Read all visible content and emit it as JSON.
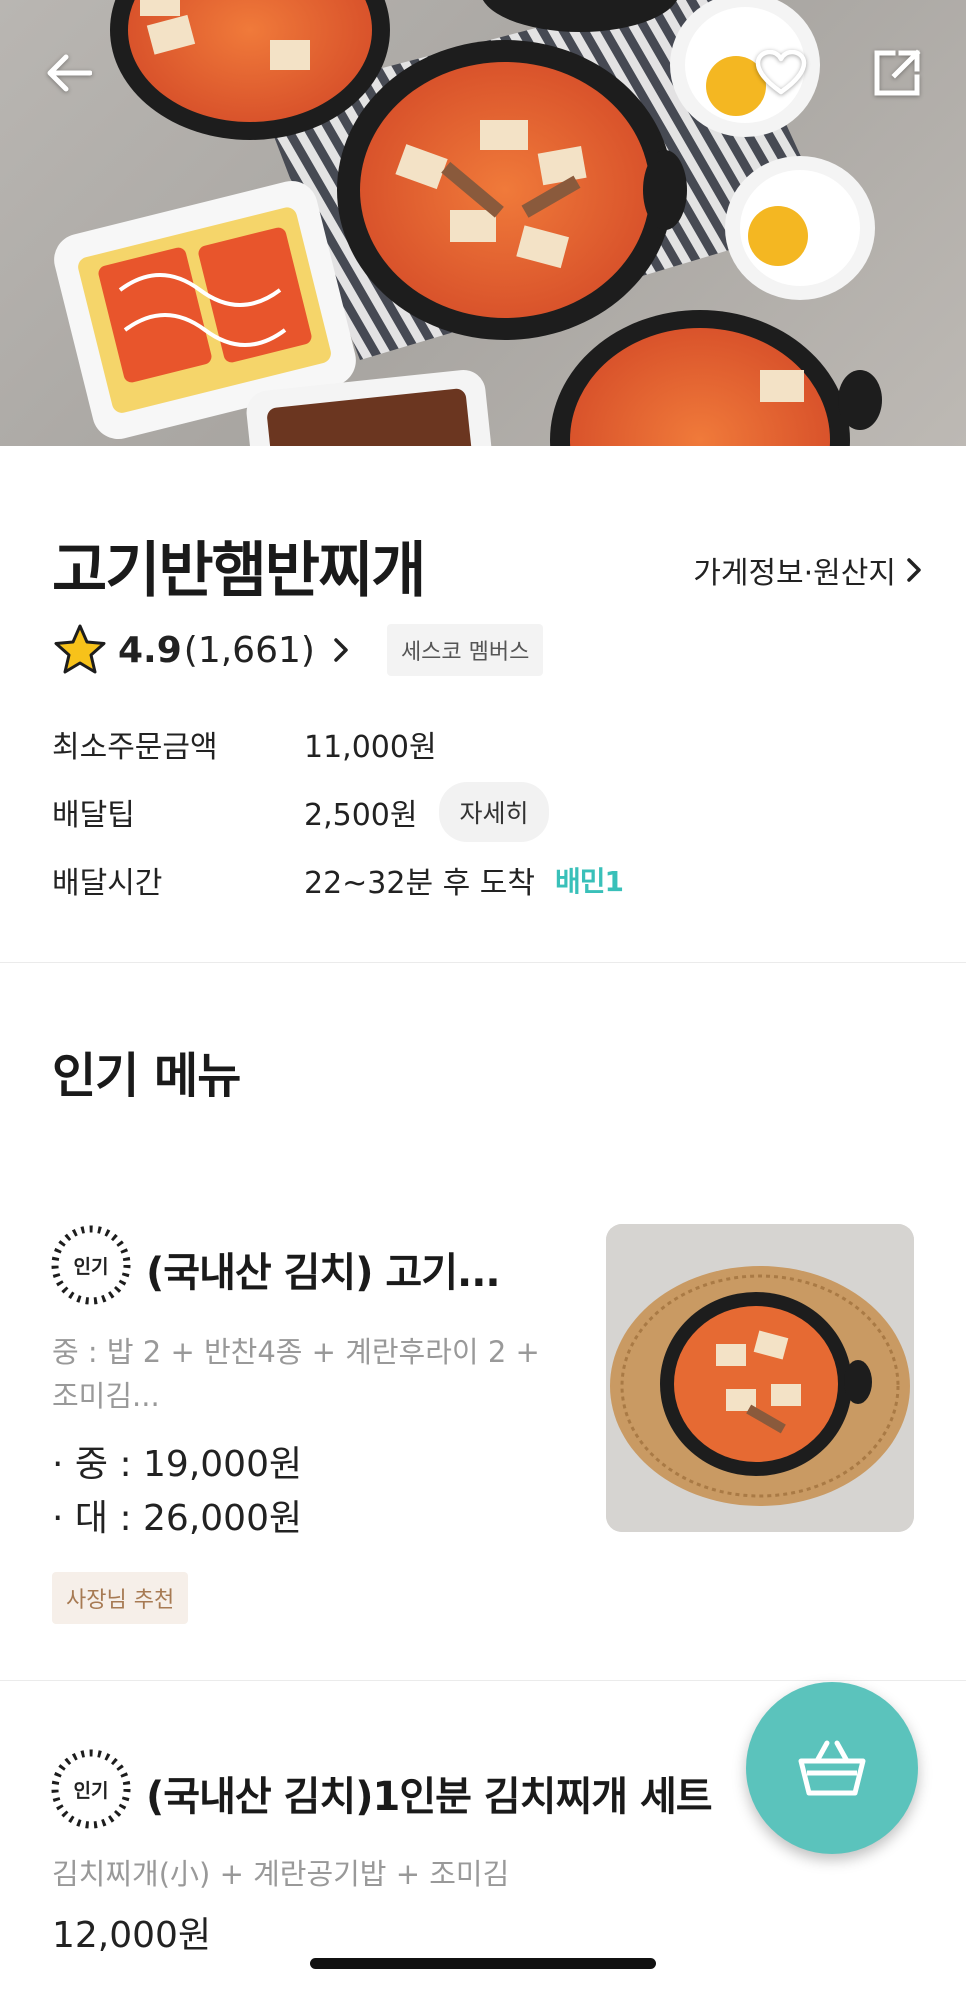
{
  "store": {
    "name": "고기반햄반찌개",
    "info_link_label": "가게정보·원산지",
    "rating": "4.9",
    "review_count": "(1,661)",
    "member_badge": "세스코 멤버스"
  },
  "delivery_info": [
    {
      "label": "최소주문금액",
      "value": "11,000원"
    },
    {
      "label": "배달팁",
      "value": "2,500원",
      "button": "자세히"
    },
    {
      "label": "배달시간",
      "value": "22~32분 후 도착",
      "service": "배민1"
    }
  ],
  "popular_section": {
    "title": "인기 메뉴",
    "badge_text": "인기",
    "items": [
      {
        "name": "(국내산 김치) 고기...",
        "desc_lines": [
          "중 : 밥 2 + 반찬4종 + 계란후라이 2 +",
          "조미김..."
        ],
        "prices": [
          "· 중 : 19,000원",
          "· 대 : 26,000원"
        ],
        "tag": "사장님 추천"
      },
      {
        "name": "(국내산 김치)1인분 김치찌개 세트",
        "desc": "김치찌개(小) + 계란공기밥 + 조미김",
        "price": "12,000원"
      }
    ]
  },
  "colors": {
    "accent": "#5bc3bc",
    "baemin1": "#39c0b9",
    "owner_badge_bg": "#f6efe9",
    "owner_badge_text": "#a77a53"
  },
  "icons": {
    "back": "arrow-left-icon",
    "like": "heart-icon",
    "share": "share-icon",
    "cart": "basket-icon",
    "star": "star-icon"
  }
}
